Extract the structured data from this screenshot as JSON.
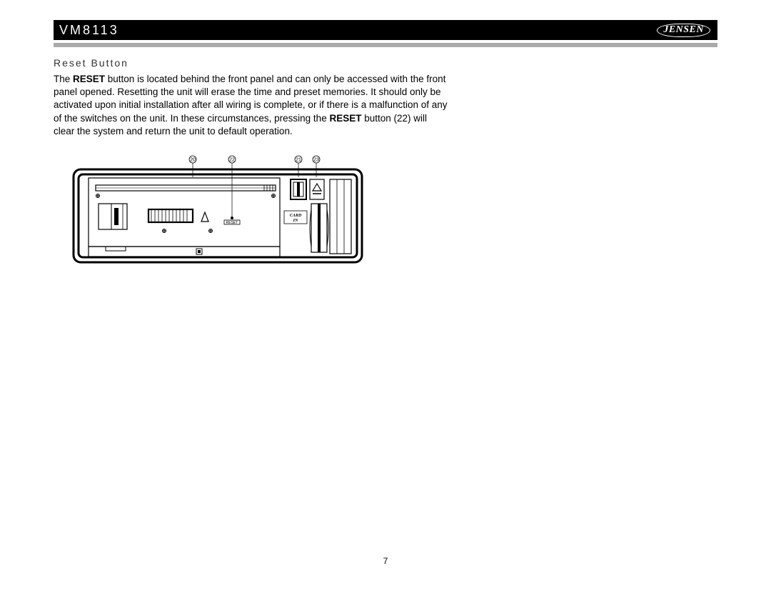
{
  "header": {
    "model": "VM8113",
    "brand": "JENSEN"
  },
  "section": {
    "title": "Reset Button",
    "para_part1": "The ",
    "para_bold1": "RESET",
    "para_part2": " button is located behind the front panel and can only be accessed with the front panel opened. Resetting the unit will erase the time and preset memories. It should only be activated upon initial installation after all wiring is complete, or if there is a malfunction of any of the switches on the unit. In these circumstances, pressing the ",
    "para_bold2": "RESET",
    "para_part3": " button (22) will clear the system and return the unit to default operation."
  },
  "diagram": {
    "callouts": {
      "c20": "20",
      "c22": "22",
      "c21": "21",
      "c23": "23"
    },
    "labels": {
      "reset": "RESET",
      "card_in_1": "CARD",
      "card_in_2": "IN"
    }
  },
  "page_number": "7"
}
